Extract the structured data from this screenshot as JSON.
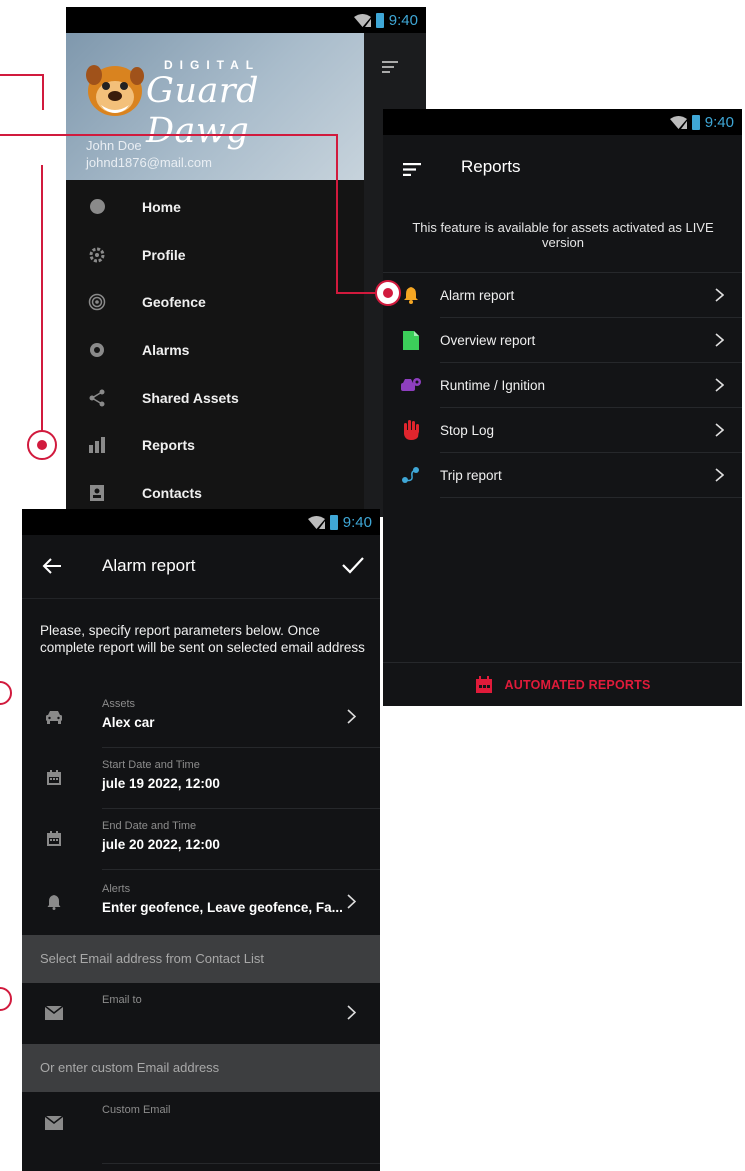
{
  "status_bar": {
    "time": "9:40"
  },
  "drawer": {
    "logo_small": "DIGITAL",
    "logo_big": "Guard Dawg",
    "user_name": "John Doe",
    "user_email": "johnd1876@mail.com",
    "items": [
      {
        "label": "Home",
        "icon": "home-icon"
      },
      {
        "label": "Profile",
        "icon": "gear-icon"
      },
      {
        "label": "Geofence",
        "icon": "geofence-icon"
      },
      {
        "label": "Alarms",
        "icon": "alarm-icon"
      },
      {
        "label": "Shared Assets",
        "icon": "share-icon"
      },
      {
        "label": "Reports",
        "icon": "bar-chart-icon"
      },
      {
        "label": "Contacts",
        "icon": "contacts-icon"
      }
    ]
  },
  "reports": {
    "title": "Reports",
    "notice": "This feature is available for assets activated as LIVE version",
    "items": [
      {
        "label": "Alarm report",
        "icon": "bell-icon",
        "color": "#f5a623"
      },
      {
        "label": "Overview report",
        "icon": "document-icon",
        "color": "#3ccf5a"
      },
      {
        "label": "Runtime / Ignition",
        "icon": "car-pin-icon",
        "color": "#8e3fbf"
      },
      {
        "label": "Stop Log",
        "icon": "hand-stop-icon",
        "color": "#e0252d"
      },
      {
        "label": "Trip report",
        "icon": "route-icon",
        "color": "#3fa7d6"
      }
    ],
    "footer_label": "AUTOMATED REPORTS"
  },
  "alarm_report": {
    "title": "Alarm report",
    "intro": "Please, specify report parameters below. Once complete report will be sent on selected email address",
    "fields": [
      {
        "label": "Assets",
        "value": "Alex car",
        "icon": "car-icon"
      },
      {
        "label": "Start Date and Time",
        "value": "jule 19 2022, 12:00",
        "icon": "calendar-icon"
      },
      {
        "label": "End Date and Time",
        "value": "jule 20 2022, 12:00",
        "icon": "calendar-icon"
      },
      {
        "label": "Alerts",
        "value": "Enter geofence, Leave geofence, Fa...",
        "icon": "bell-icon"
      }
    ],
    "section_contact": "Select Email address from Contact List",
    "email_to_label": "Email to",
    "section_custom": "Or enter custom Email address",
    "custom_email_label": "Custom Email"
  },
  "colors": {
    "accent": "#d11a3d",
    "status_blue": "#3fa7d6",
    "background": "#121315"
  }
}
